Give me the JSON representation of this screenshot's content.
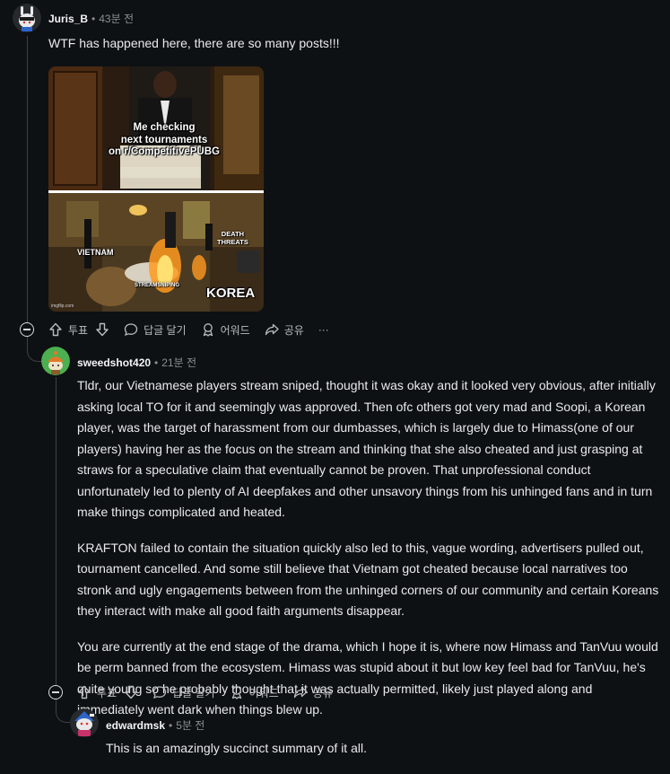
{
  "comments": [
    {
      "author": "Juris_B",
      "time": "43분 전",
      "text": [
        "WTF has happened here, there are so many posts!!!"
      ],
      "meme": {
        "top_caption": [
          "Me checking",
          "next tournaments",
          "on r/CompetitivePUBG"
        ],
        "labels": {
          "vietnam": "VIETNAM",
          "death": [
            "DEATH",
            "THREATS"
          ],
          "snipe": "STREAMSNIPING",
          "korea": "KOREA",
          "watermark": "imgflip.com"
        }
      }
    },
    {
      "author": "sweedshot420",
      "time": "21분 전",
      "text": [
        "Tldr, our Vietnamese players stream sniped, thought it was okay and it looked very obvious, after initially asking local TO for it and seemingly was approved. Then ofc others got very mad and Soopi, a Korean player, was the target of harassment from our dumbasses, which is largely due to Himass(one of our players) having her as the focus on the stream and thinking that she also cheated and just grasping at straws for a speculative claim that eventually cannot be proven. That unprofessional conduct unfortunately led to plenty of AI deepfakes and other unsavory things from his unhinged fans and in turn make things complicated and heated.",
        "KRAFTON failed to contain the situation quickly also led to this, vague wording, advertisers pulled out, tournament cancelled. And some still believe that Vietnam got cheated because local narratives too stronk and ugly engagements between from the unhinged corners of our community and certain Koreans they interact with make all good faith arguments disappear.",
        "You are currently at the end stage of the drama, which I hope it is, where now Himass and TanVuu would be perm banned from the ecosystem. Himass was stupid about it but low key feel bad for TanVuu, he's quite young so he probably thought that it was actually permitted, likely just played along and immediately went dark when things blew up."
      ]
    },
    {
      "author": "edwardmsk",
      "time": "5분 전",
      "text": [
        "This is an amazingly succinct summary of it all."
      ]
    }
  ],
  "actions": {
    "vote_label": "투표",
    "reply_label": "답글 달기",
    "award_label": "어워드",
    "share_label": "공유",
    "more_label": "···"
  },
  "colors": {
    "background": "#0e1113",
    "text": "#e8eaeb",
    "meta": "#8a8f93"
  }
}
